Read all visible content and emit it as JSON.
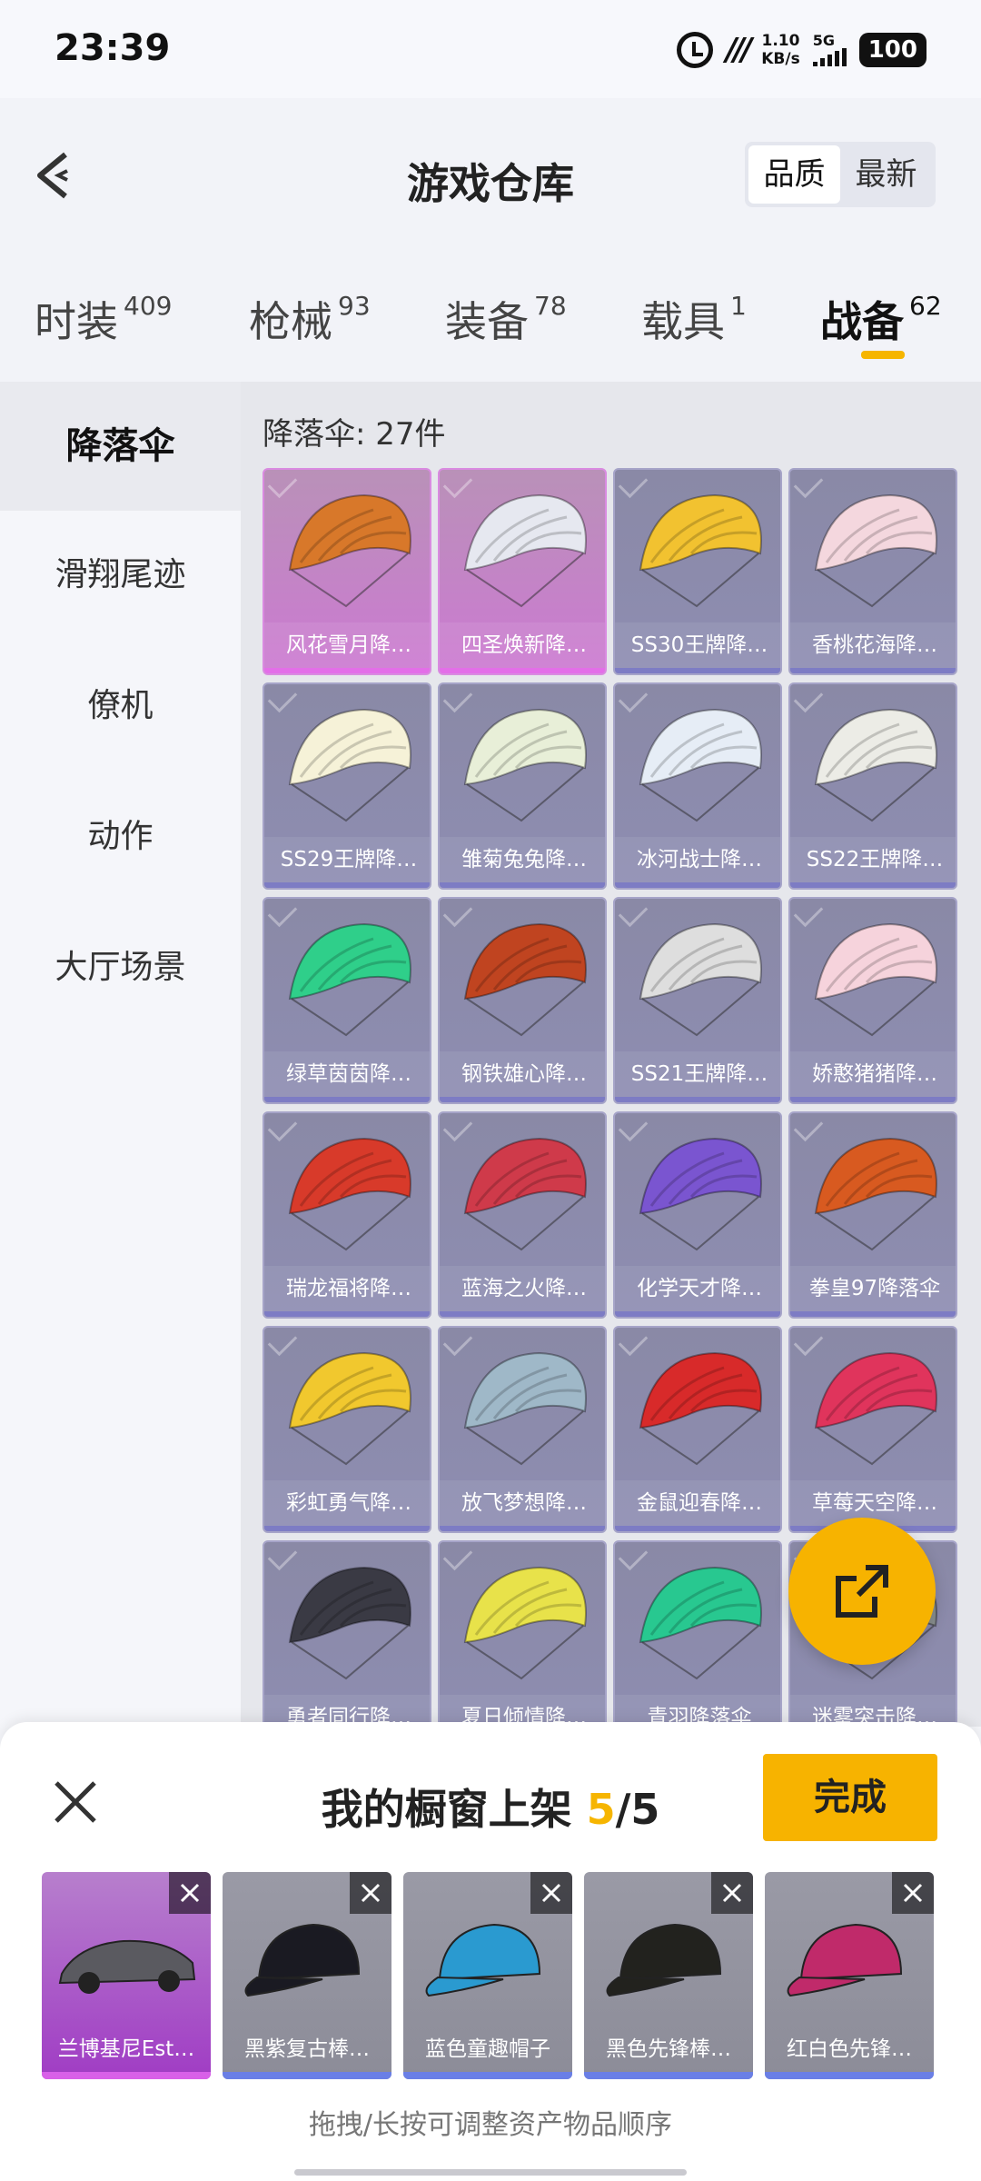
{
  "status_bar": {
    "time": "23:39",
    "speed_value": "1.10",
    "speed_unit": "KB/s",
    "network": "5G",
    "battery": "100"
  },
  "header": {
    "title": "游戏仓库",
    "sort_options": [
      "品质",
      "最新"
    ],
    "sort_active": "品质"
  },
  "tabs": [
    {
      "label": "时装",
      "count": "409"
    },
    {
      "label": "枪械",
      "count": "93"
    },
    {
      "label": "装备",
      "count": "78"
    },
    {
      "label": "载具",
      "count": "1"
    },
    {
      "label": "战备",
      "count": "62",
      "active": true
    }
  ],
  "sidebar": {
    "items": [
      "降落伞",
      "滑翔尾迹",
      "僚机",
      "动作",
      "大厅场景"
    ],
    "active": "降落伞"
  },
  "main": {
    "count_label": "降落伞: 27件",
    "items": [
      {
        "name": "风花雪月降…",
        "rarity": "legendary"
      },
      {
        "name": "四圣焕新降…",
        "rarity": "legendary"
      },
      {
        "name": "SS30王牌降…",
        "rarity": "epic"
      },
      {
        "name": "香桃花海降…",
        "rarity": "epic"
      },
      {
        "name": "SS29王牌降…",
        "rarity": "epic"
      },
      {
        "name": "雏菊兔兔降…",
        "rarity": "epic"
      },
      {
        "name": "冰河战士降…",
        "rarity": "epic"
      },
      {
        "name": "SS22王牌降…",
        "rarity": "epic"
      },
      {
        "name": "绿草茵茵降…",
        "rarity": "epic"
      },
      {
        "name": "钢铁雄心降…",
        "rarity": "epic"
      },
      {
        "name": "SS21王牌降…",
        "rarity": "epic"
      },
      {
        "name": "娇憨猪猪降…",
        "rarity": "epic"
      },
      {
        "name": "瑞龙福将降…",
        "rarity": "epic"
      },
      {
        "name": "蓝海之火降…",
        "rarity": "epic"
      },
      {
        "name": "化学天才降…",
        "rarity": "epic"
      },
      {
        "name": "拳皇97降落伞",
        "rarity": "epic"
      },
      {
        "name": "彩虹勇气降…",
        "rarity": "epic"
      },
      {
        "name": "放飞梦想降…",
        "rarity": "epic"
      },
      {
        "name": "金鼠迎春降…",
        "rarity": "epic"
      },
      {
        "name": "草莓天空降…",
        "rarity": "epic"
      },
      {
        "name": "勇者同行降…",
        "rarity": "epic"
      },
      {
        "name": "夏日倾情降…",
        "rarity": "epic"
      },
      {
        "name": "青羽降落伞",
        "rarity": "epic"
      },
      {
        "name": "迷雾突击降…",
        "rarity": "epic"
      }
    ],
    "item_colors": [
      "#d8782a",
      "#e6e8f0",
      "#f2c230",
      "#f4d7de",
      "#f6f2d8",
      "#e8efd8",
      "#e6edf6",
      "#ecece6",
      "#2fcf8a",
      "#c04420",
      "#dedede",
      "#f6d3dc",
      "#d83a2a",
      "#cf3a4a",
      "#7a55d0",
      "#d85a20",
      "#f1c82e",
      "#9fb8c8",
      "#d82a2a",
      "#e0345c",
      "#3a3a44",
      "#e8e24a",
      "#28c890",
      "#8a9090"
    ]
  },
  "bottom": {
    "title_prefix": "我的橱窗上架 ",
    "current": "5",
    "total": "/5",
    "done_label": "完成",
    "items": [
      {
        "name": "兰博基尼Est…",
        "rarity": "legendary"
      },
      {
        "name": "黑紫复古棒…",
        "rarity": "rare"
      },
      {
        "name": "蓝色童趣帽子",
        "rarity": "rare"
      },
      {
        "name": "黑色先锋棒…",
        "rarity": "rare"
      },
      {
        "name": "红白色先锋…",
        "rarity": "rare"
      }
    ],
    "hint": "拖拽/长按可调整资产物品顺序"
  },
  "colors": {
    "accent": "#f7b300",
    "legendary": "#d98be0",
    "epic": "#8e8db2"
  }
}
